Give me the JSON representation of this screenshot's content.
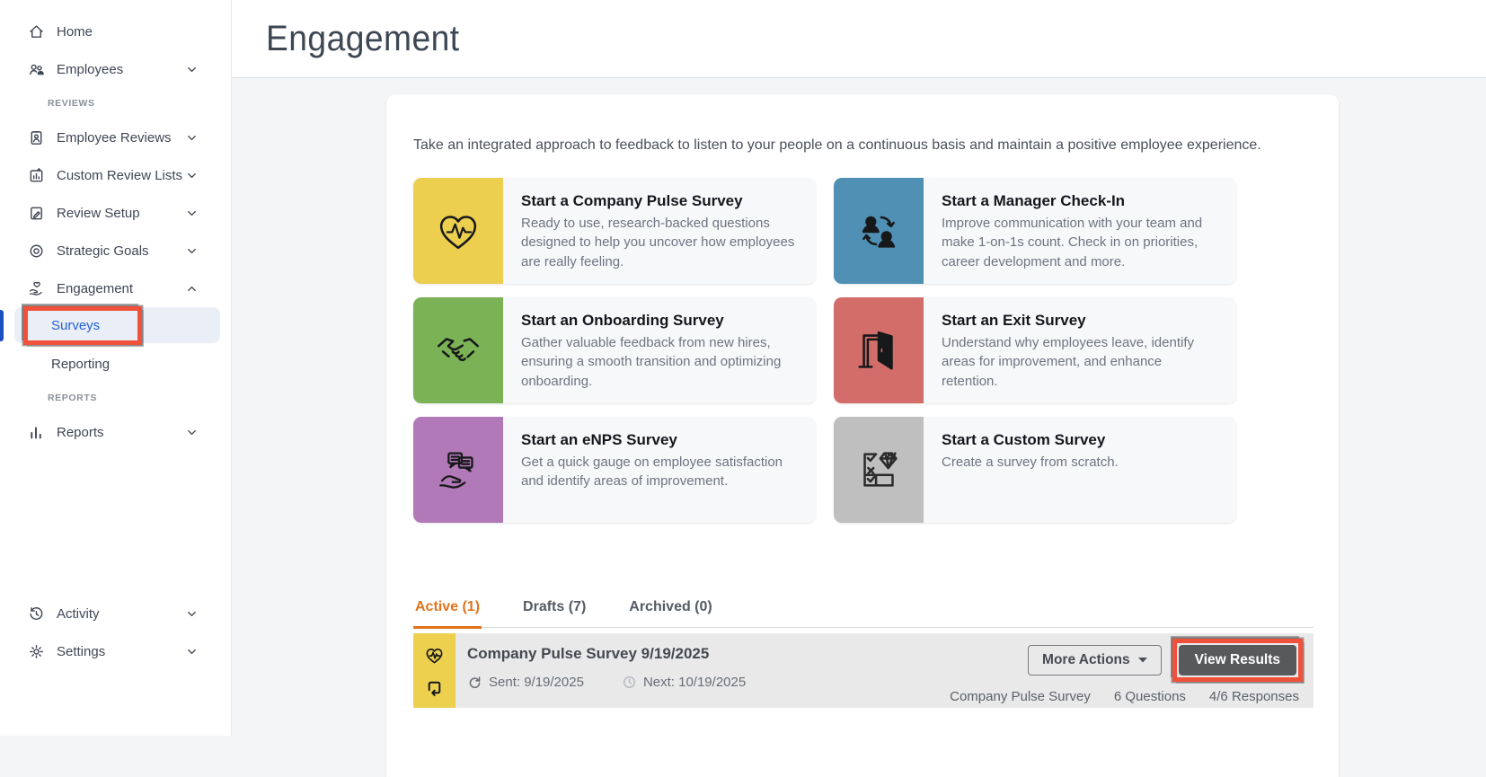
{
  "header": {
    "title": "Engagement"
  },
  "sidebar": {
    "items": [
      {
        "label": "Home"
      },
      {
        "label": "Employees"
      },
      {
        "label": "REVIEWS"
      },
      {
        "label": "Employee Reviews"
      },
      {
        "label": "Custom Review Lists"
      },
      {
        "label": "Review Setup"
      },
      {
        "label": "Strategic Goals"
      },
      {
        "label": "Engagement"
      },
      {
        "label": "Surveys",
        "active": true
      },
      {
        "label": "Reporting"
      },
      {
        "label": "REPORTS"
      },
      {
        "label": "Reports"
      },
      {
        "label": "Activity"
      },
      {
        "label": "Settings"
      }
    ]
  },
  "intro": "Take an integrated approach to feedback to listen to your people on a continuous basis and maintain a positive employee experience.",
  "tiles": [
    {
      "title": "Start a Company Pulse Survey",
      "description": "Ready to use, research-backed questions designed to help you uncover how employees are really feeling.",
      "color": "#eccf4f",
      "icon": "pulse-heart-icon"
    },
    {
      "title": "Start a Manager Check-In",
      "description": "Improve communication with your team and make 1-on-1s count. Check in on priorities, career development and more.",
      "color": "#4f90b4",
      "icon": "manager-checkin-icon"
    },
    {
      "title": "Start an Onboarding Survey",
      "description": "Gather valuable feedback from new hires, ensuring a smooth transition and optimizing onboarding.",
      "color": "#7ab255",
      "icon": "handshake-icon"
    },
    {
      "title": "Start an Exit Survey",
      "description": "Understand why employees leave, identify areas for improvement, and enhance retention.",
      "color": "#d26d69",
      "icon": "exit-door-icon"
    },
    {
      "title": "Start an eNPS Survey",
      "description": "Get a quick gauge on employee satisfaction and identify areas of improvement.",
      "color": "#b279b8",
      "icon": "enps-feedback-icon"
    },
    {
      "title": "Start a Custom Survey",
      "description": "Create a survey from scratch.",
      "color": "#bfbfbf",
      "icon": "custom-survey-icon"
    }
  ],
  "tabs": [
    {
      "label": "Active (1)",
      "active": true
    },
    {
      "label": "Drafts (7)",
      "active": false
    },
    {
      "label": "Archived (0)",
      "active": false
    }
  ],
  "survey_row": {
    "title": "Company Pulse Survey 9/19/2025",
    "sent": "Sent: 9/19/2025",
    "next": "Next: 10/19/2025",
    "more_actions": "More Actions",
    "view_results": "View Results",
    "meta": [
      "Company Pulse Survey",
      "6 Questions",
      "4/6 Responses"
    ]
  },
  "colors": {
    "active_tab": "#e2731c",
    "sidebar_active_link": "#2461d9",
    "active_indicator": "#1b4fc0",
    "annotation": "#f1503a",
    "view_results_bg": "#58595b",
    "row_bg": "#e9e9ea",
    "tile_yellow": "#eccf4f",
    "tile_blue": "#4f90b4",
    "tile_green": "#7ab255",
    "tile_red": "#d26d69",
    "tile_purple": "#b279b8",
    "tile_gray": "#bfbfbf"
  }
}
